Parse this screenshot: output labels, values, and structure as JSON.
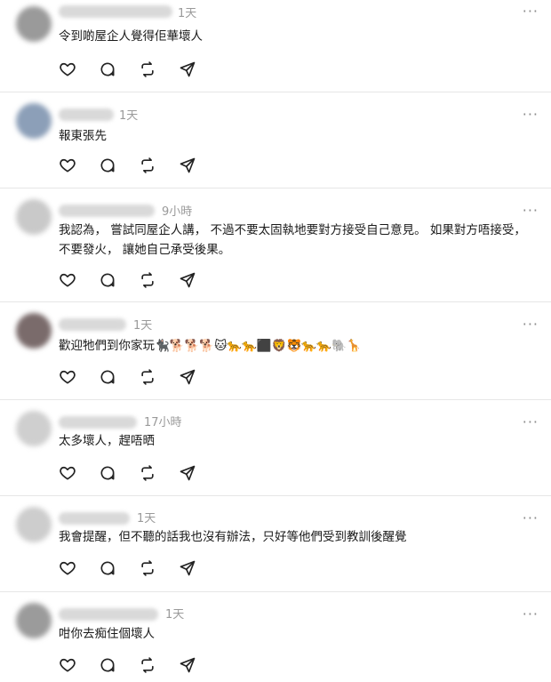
{
  "posts": [
    {
      "username": "user_1",
      "time": "1天",
      "text": "令到啲屋企人覺得佢華壞人"
    },
    {
      "username": "user_2",
      "time": "1天",
      "text": "報東張先"
    },
    {
      "username": "user_3",
      "time": "9小時",
      "text": "我認為， 嘗試同屋企人講， 不過不要太固執地要對方接受自己意見。 如果對方唔接受， 不要發火， 讓她自己承受後果。"
    },
    {
      "username": "user_4",
      "time": "1天",
      "text": "歡迎牠們到你家玩🐈‍⬛🐕🐕🐕🐱🐆🐆⬛🦁🐯🐆🐆🐘🦒"
    },
    {
      "username": "user_5",
      "time": "17小時",
      "text": "太多壞人，趕唔晒"
    },
    {
      "username": "user_6",
      "time": "1天",
      "text": "我會提醒，但不聽的話我也沒有辦法，只好等他們受到教訓後醒覺"
    },
    {
      "username": "user_7",
      "time": "1天",
      "text": "咁你去痴住個壞人"
    }
  ],
  "icons": {
    "like": "heart-icon",
    "comment": "comment-icon",
    "repost": "repost-icon",
    "share": "share-icon",
    "more": "more-icon"
  },
  "more_glyph": "···"
}
